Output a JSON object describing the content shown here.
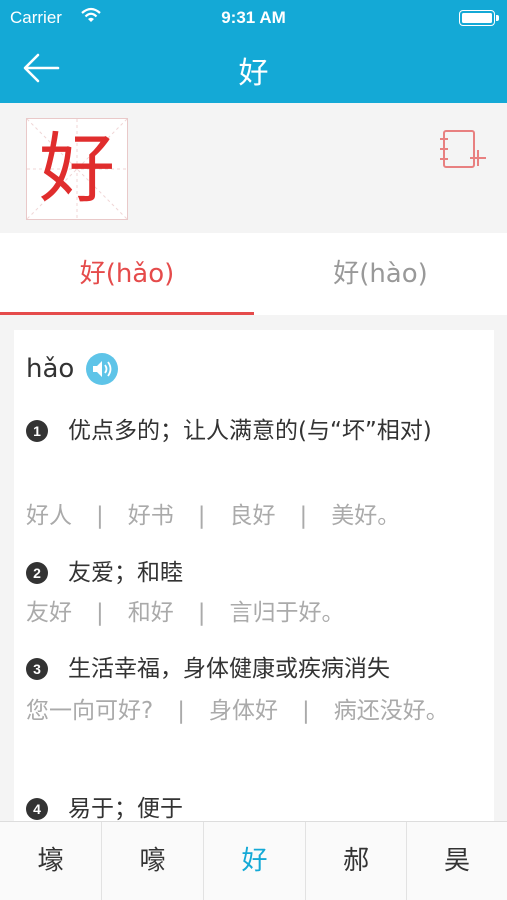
{
  "status_bar": {
    "carrier": "Carrier",
    "time": "9:31 AM"
  },
  "nav": {
    "title": "好"
  },
  "character": {
    "glyph": "好"
  },
  "tabs": [
    {
      "label": "好(hǎo)",
      "active": true
    },
    {
      "label": "好(hào)",
      "active": false
    }
  ],
  "entry": {
    "pinyin": "hǎo",
    "definitions": [
      {
        "num": "1",
        "text": "优点多的；让人满意的(与“坏”相对)",
        "examples": [
          "好人",
          "好书",
          "良好",
          "美好。"
        ]
      },
      {
        "num": "2",
        "text": "友爱；和睦",
        "examples": [
          "友好",
          "和好",
          "言归于好。"
        ]
      },
      {
        "num": "3",
        "text": "生活幸福，身体健康或疾病消失",
        "examples": [
          "您一向可好?",
          "身体好",
          "病还没好。"
        ]
      },
      {
        "num": "4",
        "text": "易于；便于",
        "examples": []
      }
    ]
  },
  "bottom_chars": [
    {
      "char": "壕",
      "active": false
    },
    {
      "char": "嚎",
      "active": false
    },
    {
      "char": "好",
      "active": true
    },
    {
      "char": "郝",
      "active": false
    },
    {
      "char": "昊",
      "active": false
    }
  ],
  "colors": {
    "primary": "#14a9d6",
    "accent_red": "#e54b4b",
    "char_red": "#e02d2d"
  },
  "icons": [
    "wifi-icon",
    "battery-icon",
    "back-arrow-icon",
    "notebook-add-icon",
    "speaker-icon"
  ]
}
